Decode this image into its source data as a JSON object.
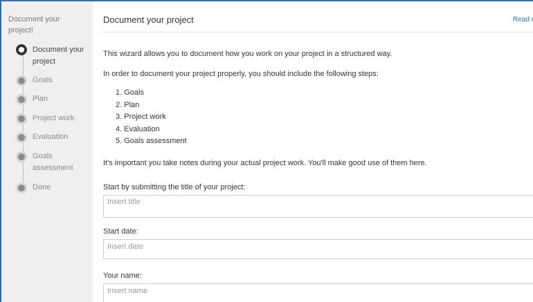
{
  "sidebar": {
    "title": "Document your project!",
    "steps": [
      {
        "label": "Document your project",
        "active": true
      },
      {
        "label": "Goals",
        "active": false
      },
      {
        "label": "Plan",
        "active": false
      },
      {
        "label": "Project work",
        "active": false
      },
      {
        "label": "Evaluation",
        "active": false
      },
      {
        "label": "Goals assessment",
        "active": false
      },
      {
        "label": "Done",
        "active": false
      }
    ]
  },
  "header": {
    "title": "Document your project",
    "read_more": "Read m"
  },
  "content": {
    "intro": "This wizard allows you to document how you work on your project in a structured way.",
    "steps_intro": "In order to document your project properly, you should include the following steps:",
    "steps_list": [
      "1. Goals",
      "2. Plan",
      "3. Project work",
      "4. Evaluation",
      "5. Goals assessment"
    ],
    "notes": "It's important you take notes during your actual project work. You'll make good use of them here."
  },
  "form": {
    "title_label": "Start by submitting the title of your project:",
    "title_placeholder": "Insert title",
    "date_label": "Start date:",
    "date_placeholder": "Insert date",
    "name_label": "Your name:",
    "name_placeholder": "Insert name"
  },
  "colors": {
    "accent": "#2d6db2",
    "sidebar_bg": "#efefef"
  }
}
